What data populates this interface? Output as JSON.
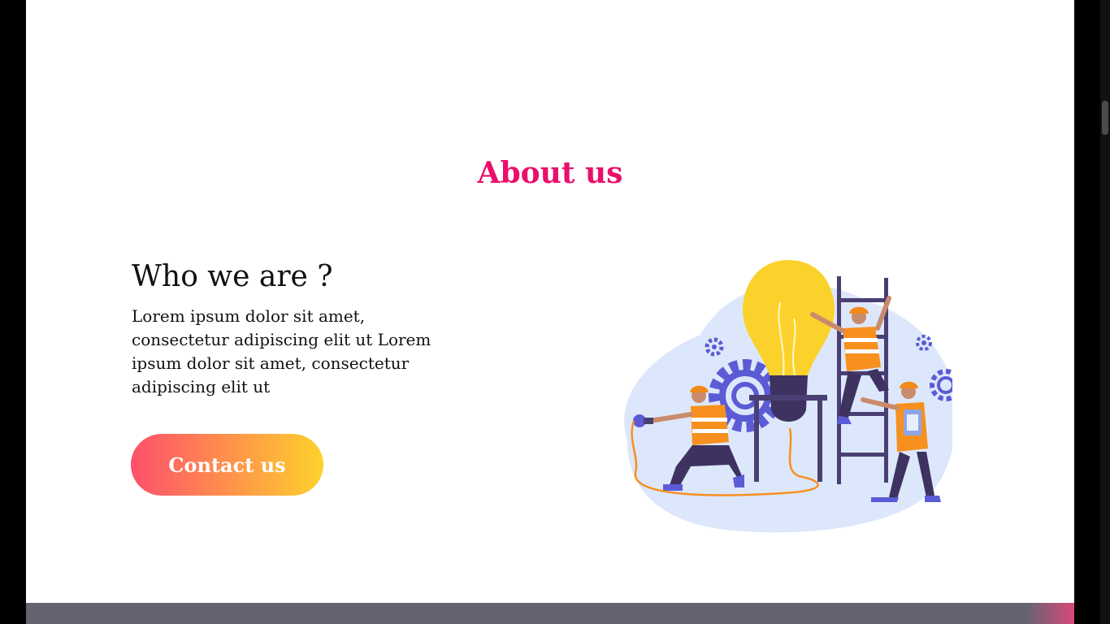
{
  "about": {
    "title": "About us",
    "subtitle": "Who we are ?",
    "description": "Lorem ipsum dolor sit amet, consectetur adipiscing elit ut Lorem ipsum dolor sit amet, consectetur adipiscing elit ut",
    "cta_label": "Contact us"
  },
  "colors": {
    "title": "#ea0f6b",
    "button_gradient_start": "#fe4f6c",
    "button_gradient_end": "#fdd22c",
    "footer": "#636470"
  },
  "illustration": {
    "icon": "workers-lightbulb-illustration"
  }
}
